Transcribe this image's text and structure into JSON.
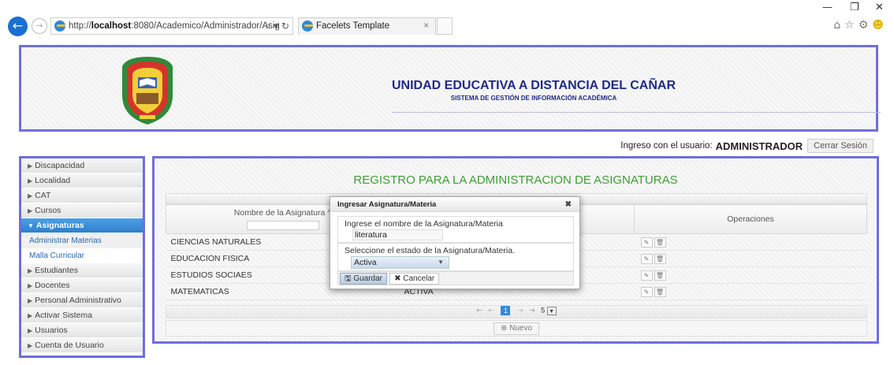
{
  "browser": {
    "url_prefix": "http://",
    "url_host": "localhost",
    "url_rest": ":8080/Academico/Administrador/Asig",
    "tab_title": "Facelets Template"
  },
  "header": {
    "institution": "UNIDAD EDUCATIVA A DISTANCIA DEL CAÑAR",
    "system": "SISTEMA DE GESTIÓN DE INFORMACIÓN ACADÉMICA"
  },
  "user": {
    "prefix": "Ingreso con el usuario:",
    "name": "ADMINISTRADOR",
    "logout_label": "Cerrar Sesión"
  },
  "sidebar": {
    "items": [
      {
        "label": "Discapacidad"
      },
      {
        "label": "Localidad"
      },
      {
        "label": "CAT"
      },
      {
        "label": "Cursos"
      },
      {
        "label": "Asignaturas"
      },
      {
        "label": "Administrar Materias"
      },
      {
        "label": "Malla Curricular"
      },
      {
        "label": "Estudiantes"
      },
      {
        "label": "Docentes"
      },
      {
        "label": "Personal Administrativo"
      },
      {
        "label": "Activar Sistema"
      },
      {
        "label": "Usuarios"
      },
      {
        "label": "Cuenta de Usuario"
      }
    ]
  },
  "main": {
    "title": "REGISTRO PARA LA ADMINISTRACION DE ASIGNATURAS",
    "columns": [
      "Nombre de la Asignatura ^",
      "Operaciones"
    ],
    "rows": [
      {
        "name": "CIENCIAS NATURALES",
        "status": ""
      },
      {
        "name": "EDUCACION FISICA",
        "status": ""
      },
      {
        "name": "ESTUDIOS SOCIAES",
        "status": ""
      },
      {
        "name": "MATEMATICAS",
        "status": "ACTIVA"
      }
    ],
    "pager": {
      "current_page": "1",
      "rows_per_page": "5"
    },
    "new_label": "Nuevo"
  },
  "dialog": {
    "title": "Ingresar Asignatura/Materia",
    "name_label": "Ingrese el nombre de la Asignatura/Materia",
    "name_value": "literatura",
    "status_label": "Seleccione el estado de la Asignatura/Materia.",
    "status_value": "Activa",
    "save_label": "Guardar",
    "cancel_label": "Cancelar"
  },
  "colors": {
    "border_accent": "#6e6ee0",
    "title_green": "#3f9e37",
    "heading_blue": "#1f2a8a",
    "active_menu": "#2d7fcb"
  }
}
